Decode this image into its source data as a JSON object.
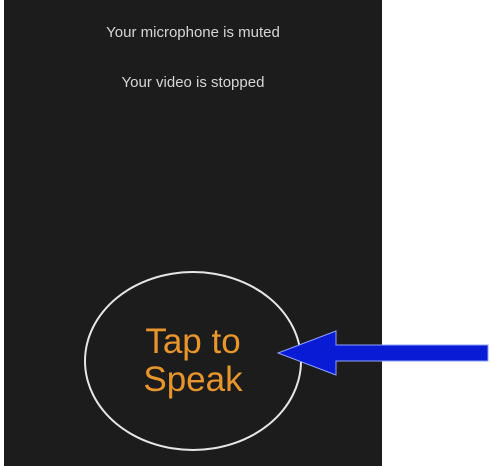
{
  "status": {
    "microphone": "Your microphone is muted",
    "video": "Your video is stopped"
  },
  "tap_button": {
    "label": "Tap to Speak"
  },
  "colors": {
    "screen_background": "#1c1c1c",
    "status_text": "#d6d6d6",
    "tap_label": "#e8952c",
    "tap_ring": "#e6e6e6",
    "arrow": "#0a1bd6"
  },
  "annotation": {
    "icon": "blue-arrow-icon",
    "direction": "left"
  }
}
